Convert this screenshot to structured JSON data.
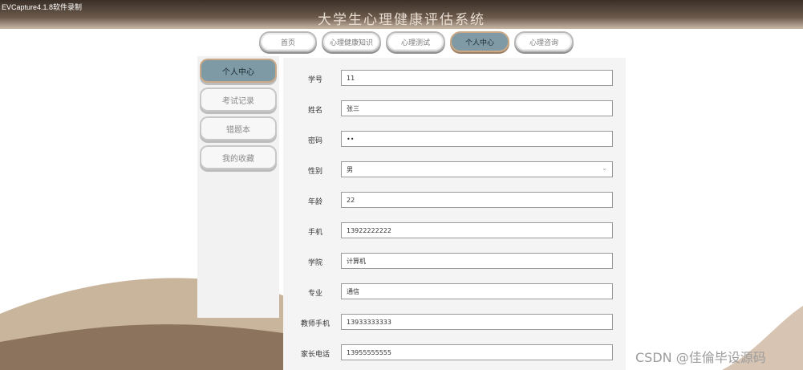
{
  "watermark_app": "EVCapture4.1.8软件录制",
  "site_title": "大学生心理健康评估系统",
  "nav": [
    {
      "label": "首页"
    },
    {
      "label": "心理健康知识"
    },
    {
      "label": "心理测试"
    },
    {
      "label": "个人中心"
    },
    {
      "label": "心理咨询"
    }
  ],
  "sidebar": [
    {
      "label": "个人中心"
    },
    {
      "label": "考试记录"
    },
    {
      "label": "错题本"
    },
    {
      "label": "我的收藏"
    }
  ],
  "form": {
    "fields": [
      {
        "label": "学号",
        "value": "11"
      },
      {
        "label": "姓名",
        "value": "张三"
      },
      {
        "label": "密码",
        "value": "••"
      },
      {
        "label": "性别",
        "value": "男"
      },
      {
        "label": "年龄",
        "value": "22"
      },
      {
        "label": "手机",
        "value": "13922222222"
      },
      {
        "label": "学院",
        "value": "计算机"
      },
      {
        "label": "专业",
        "value": "通信"
      },
      {
        "label": "教师手机",
        "value": "13933333333"
      },
      {
        "label": "家长电话",
        "value": "13955555555"
      }
    ]
  },
  "csdn_watermark": "CSDN @佳倫毕设源码",
  "colors": {
    "accent": "#7f9aa5",
    "accent_border": "#c8a886",
    "topbar": "#3a2f27"
  }
}
